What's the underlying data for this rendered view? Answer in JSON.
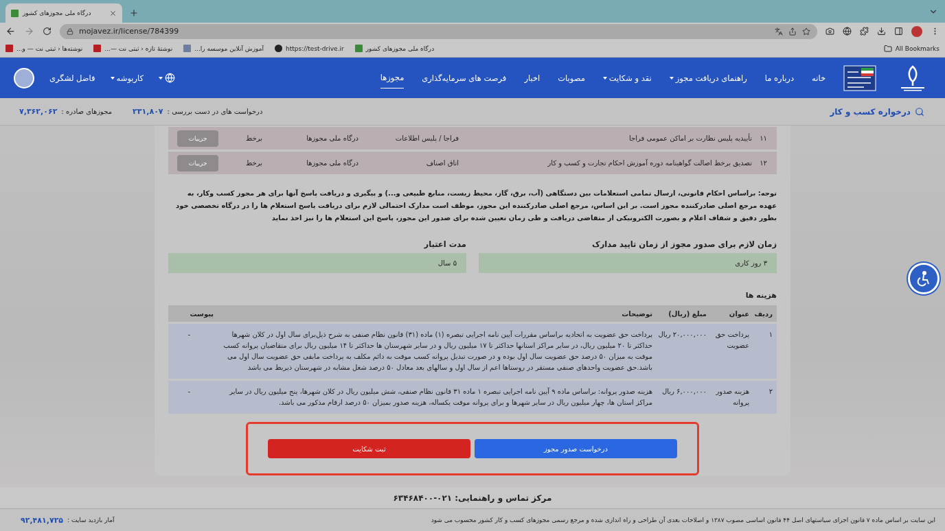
{
  "browser": {
    "tab_title": "درگاه ملی مجوزهای کشور",
    "url": "mojavez.ir/license/784399",
    "bookmarks": [
      {
        "label": "درگاه ملی مجوزهای کشور",
        "kind": "flag"
      },
      {
        "label": "https://test-drive.ir",
        "kind": "web"
      },
      {
        "label": "آموزش آنلاین موسسه را...",
        "kind": "school"
      },
      {
        "label": "نوشتهٔ تازه ‹ ثبتی نت —...",
        "kind": "site"
      },
      {
        "label": "نوشته‌ها ‹ ثبتی نت — و...",
        "kind": "site"
      }
    ],
    "bookmarks_folder": "All Bookmarks"
  },
  "header": {
    "nav": [
      {
        "label": "خانه",
        "selected": false,
        "dropdown": false
      },
      {
        "label": "درباره ما",
        "selected": false,
        "dropdown": false
      },
      {
        "label": "راهنمای دریافت مجوز",
        "selected": false,
        "dropdown": true
      },
      {
        "label": "نقد و شکایت",
        "selected": false,
        "dropdown": true
      },
      {
        "label": "مصوبات",
        "selected": false,
        "dropdown": false
      },
      {
        "label": "اخبار",
        "selected": false,
        "dropdown": false
      },
      {
        "label": "فرصت های سرمایه‌گذاری",
        "selected": false,
        "dropdown": false
      },
      {
        "label": "مجوزها",
        "selected": true,
        "dropdown": false
      }
    ],
    "cartable": "کاربوشه",
    "user": "فاضل لشگری"
  },
  "subheader": {
    "brand": "درخواره کسب و کار",
    "pending_label": "درخواست های در دست بررسی :",
    "pending": "۲۳۱,۸۰۷",
    "issued_label": "مجوزهای صادره :",
    "issued": "۷,۳۶۲,۰۶۲"
  },
  "inquiries": [
    {
      "index": "۱۱",
      "title": "تأییدیه پلیس نظارت بر اماکن عمومی فراجا",
      "authority": "فراجا / پلیس اطلاعات",
      "portal": "درگاه ملی مجوزها",
      "mode": "برخط",
      "button": "جزییات",
      "disabled": true
    },
    {
      "index": "۱۲",
      "title": "تصدیق برخط اصالت گواهینامه دوره آموزش احکام تجارت و کسب و کار",
      "authority": "اتاق اصناف",
      "portal": "درگاه ملی مجوزها",
      "mode": "برخط",
      "button": "جزییات",
      "disabled": true
    }
  ],
  "note": "توجه: براساس احکام قانونی، ارسال تمامی استعلامات بین دستگاهی (آب، برق، گاز، محیط زیست، منابع طبیعی و...) و پیگیری و دریافت پاسخ آنها برای هر مجوز کسب وکار، به عهده مرجع اصلی صادرکننده مجوز است. بر این اساس، مرجع اصلی صادرکننده این مجوز، موظف است مدارک احتمالی لازم برای دریافت پاسخ استعلام ها را در درگاه تخصصی خود بطور دقیق و شفاف اعلام و بصورت الکترونیکی از متقاضی دریافت و طی زمان تعیین شده برای صدور این مجوز، پاسخ این استعلام ها را نیز اخذ نماید",
  "durations": [
    {
      "label": "زمان لازم برای صدور مجوز از زمان تایید مدارک",
      "value": "۳ روز کاری"
    },
    {
      "label": "مدت اعتبار",
      "value": "۵ سال"
    }
  ],
  "costs": {
    "title": "هزینه ها",
    "columns": [
      "ردیف",
      "عنوان",
      "مبلغ (ریال)",
      "توضیحات",
      "پیوست"
    ],
    "rows": [
      {
        "index": "۱",
        "title": "پرداخت حق عضویت",
        "amount": "۲۰,۰۰۰,۰۰۰ ریال",
        "description": "پرداخت حق عضویت به اتحادیه براساس مقررات آیین نامه اجرایی تبصره (۱) ماده (۳۱) قانون نظام صنفی به شرح ذیل‌برای سال اول در کلان شهرها حداکثر تا ۲۰ میلیون ریال، در سایر مراکز استانها حداکثر تا ۱۷ میلیون ریال و در سایر شهرستان ها حداکثر تا ۱۴ میلیون ریال برای متقاضیان پروانه کسب موقت به میزان ۵۰ درصد حق عضویت سال اول بوده و در صورت تبدیل پروانه کسب موقت به دائم مکلف به پرداخت مابقی حق عضویت سال اول می باشد.حق عضویت واحدهای صنفی مستقر در روستاها اعم از سال اول و سالهای بعد معادل ۵۰ درصد شغل مشابه در شهرستان ذیربط می باشد",
        "attachment": "-"
      },
      {
        "index": "۲",
        "title": "هزینه صدور پروانه",
        "amount": "۶,۰۰۰,۰۰۰ ریال",
        "description": "هزینه صدور پروانه: براساس ماده ۹ آیین نامه اجرایی تبصره ۱ ماده ۳۱ قانون نظام صنفی، شش میلیون ریال در کلان شهرها، پنج میلیون ریال در سایر مراکز استان ها، چهار میلیون ریال در سایر شهرها و برای پروانه موقت یکساله، هزینه صدور بمیزان ۵۰ درصد ارقام مذکور می باشد.",
        "attachment": "-"
      }
    ]
  },
  "actions": [
    {
      "label": "درخواست  صدور مجوز",
      "kind": "primary"
    },
    {
      "label": "ثبت شکایت",
      "kind": "danger"
    }
  ],
  "contact": "مرکز تماس و راهنمایی: ۰۲۱-۶۳۴۶۸۴۰۰",
  "footer": {
    "statement": "این سایت بر اساس ماده ۷ قانون اجرای سیاستهای اصل ۴۴ قانون اساسی مصوب ۱۳۸۷ و اصلاحات بعدی آن طراحی و راه اندازی شده و مرجع رسمی مجوزهای کسب و کار کشور محسوب می شود",
    "visits_label": "آمار بازدید سایت :",
    "visits": "۹۲,۴۸۱,۷۲۵"
  }
}
